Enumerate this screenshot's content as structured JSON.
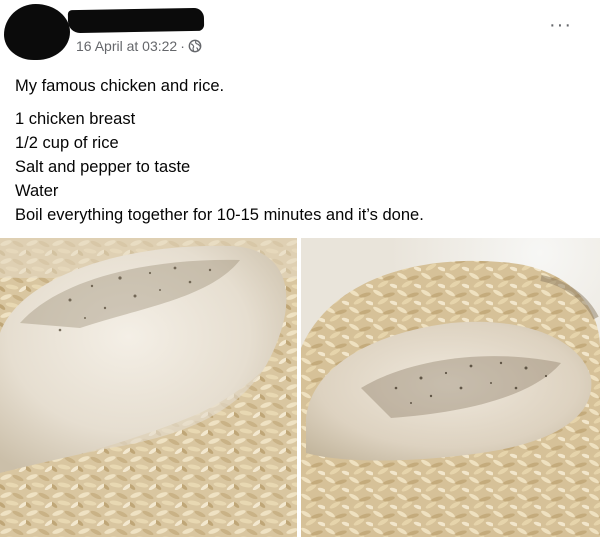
{
  "post": {
    "timestamp": "16 April at 03:22",
    "separator": "·",
    "more_label": "···",
    "caption": "My famous chicken and rice.",
    "lines": [
      "1 chicken breast",
      "1/2 cup of rice",
      "Salt and pepper to taste",
      "Water",
      "Boil everything together for 10-15 minutes and it’s done."
    ]
  },
  "icons": {
    "privacy": "globe-icon",
    "menu": "more-options-icon"
  },
  "colors": {
    "meta_text": "#65676b",
    "body_text": "#050505",
    "redaction": "#0b0b0b",
    "rice": "#d8c39a",
    "chicken": "#ece6dc"
  }
}
